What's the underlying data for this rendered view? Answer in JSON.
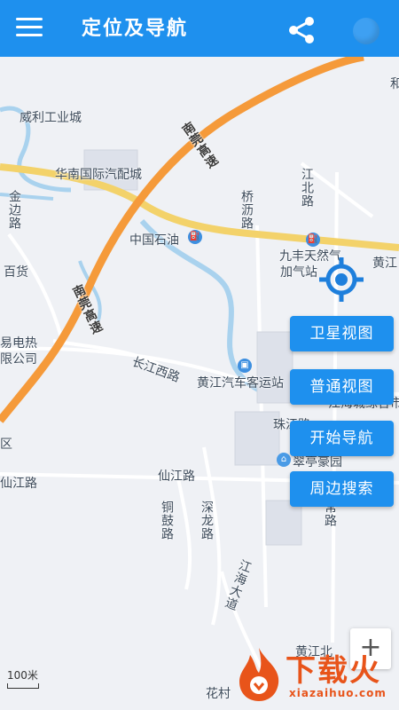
{
  "appbar": {
    "title": "定位及导航",
    "menu_icon": "hamburger-menu-icon",
    "share_icon": "share-icon"
  },
  "map": {
    "labels": {
      "weili": "威利工业城",
      "huanan": "华南国际汽配城",
      "jinbian": "金边路",
      "baihuo": "百货",
      "yidianre": "易电热",
      "xiangongsi": "限公司",
      "qu": "区",
      "xianjiang_left": "仙江路",
      "nanguan1": "南莞高速",
      "nanguan2": "南莞高速",
      "zhongguo": "中国石油",
      "qiaoli": "桥沥路",
      "jiangbei": "江北路",
      "jiufeng": "九丰天然气",
      "jiaqizhan": "加气站",
      "huangjiang_right": "黄江",
      "he": "和",
      "changjiang": "长江西路",
      "huangjiang_bus": "黄江汽车客运站",
      "jianghai": "江海城综合市场",
      "zhujiang": "珠江路",
      "cuiting": "翠亭豪园",
      "xianjiang": "仙江路",
      "tonggu": "铜鼓路",
      "shenlong": "深龙路",
      "jianghaidadao": "江海大道",
      "huangjiangbei": "黄江北",
      "huacun": "花村",
      "shanglu": "常路"
    }
  },
  "actions": {
    "satellite": "卫星视图",
    "normal": "普通视图",
    "navigate": "开始导航",
    "nearby": "周边搜索"
  },
  "controls": {
    "zoom_in": "+",
    "scale": "100米"
  },
  "watermark": {
    "text": "下载火",
    "url": "xiazaihuo.com"
  },
  "colors": {
    "appbar": "#1e90ee",
    "highway": "#f59a3a",
    "arterial": "#f3d26a",
    "water": "#a9d2ee"
  }
}
